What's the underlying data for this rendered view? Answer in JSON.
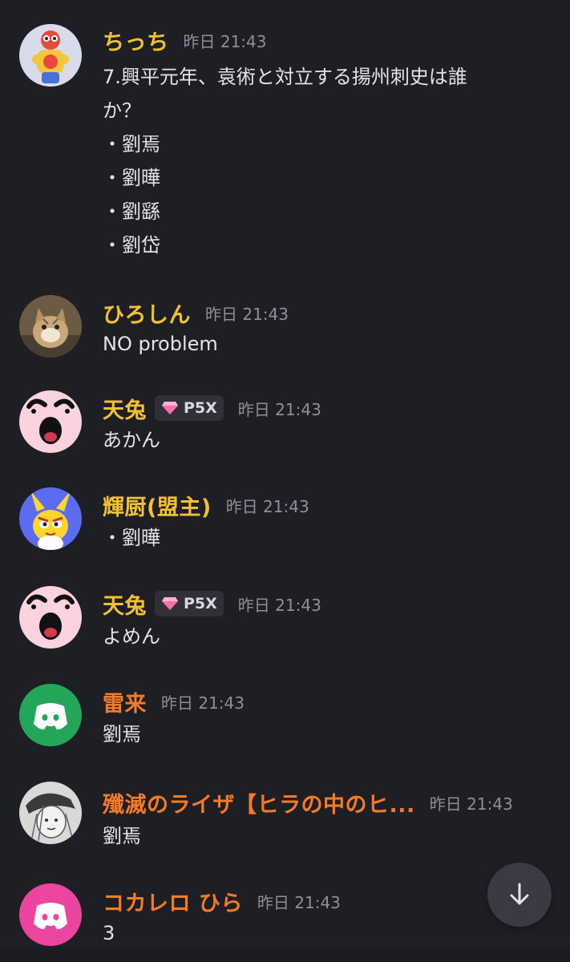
{
  "messages": [
    {
      "author": "ちっち",
      "time": "昨日 21:43",
      "lines": [
        "7.興平元年、袁術と対立する揚州刺史は誰",
        "か？",
        "・劉焉",
        "・劉曄",
        "・劉繇",
        "・劉岱"
      ]
    },
    {
      "author": "ひろしん",
      "time": "昨日 21:43",
      "text": "NO problem"
    },
    {
      "author": "天兔",
      "time": "昨日 21:43",
      "badge": "P5X",
      "text": "あかん"
    },
    {
      "author": "輝厨(盟主)",
      "time": "昨日 21:43",
      "text": "・劉曄"
    },
    {
      "author": "天兔",
      "time": "昨日 21:43",
      "badge": "P5X",
      "text": "よめん"
    },
    {
      "author": "雷来",
      "time": "昨日 21:43",
      "text": "劉焉"
    },
    {
      "author": "殲滅のライザ【ヒラの中のヒ...",
      "time": "昨日 21:43",
      "text": "劉焉"
    },
    {
      "author": "コカレロ ひら",
      "time": "昨日 21:43",
      "text": "3"
    }
  ],
  "colors": {
    "background": "#1e1f24",
    "name_yellow": "#f2c132",
    "name_orange": "#f47b26",
    "timestamp": "#8d9098",
    "discord_green": "#23a55a",
    "discord_pink": "#eb459f"
  },
  "icons": {
    "scroll_down": "arrow-down-icon",
    "badge": "gem-icon",
    "default_avatar": "discord-logo-icon"
  }
}
